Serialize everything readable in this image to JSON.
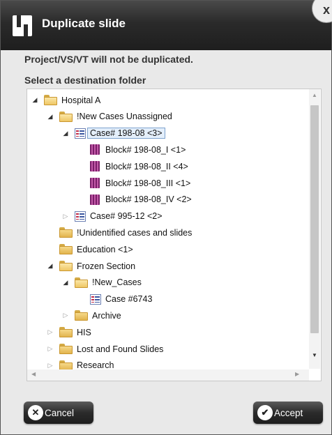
{
  "dialog": {
    "title": "Duplicate slide",
    "close_label": "x",
    "message": "Project/VS/VT will not be duplicated.",
    "select_label": "Select a destination folder"
  },
  "tree": {
    "items": [
      {
        "label": "Hospital A",
        "icon": "folder-open-icon",
        "expander": "expanded",
        "depth": 0
      },
      {
        "label": "!New Cases Unassigned",
        "icon": "folder-open-icon",
        "expander": "expanded",
        "depth": 1
      },
      {
        "label": "Case# 198-08 <3>",
        "icon": "case-icon",
        "expander": "expanded",
        "depth": 2,
        "selected": true
      },
      {
        "label": "Block# 198-08_I <1>",
        "icon": "block-icon",
        "expander": "none",
        "depth": 3
      },
      {
        "label": "Block# 198-08_II <4>",
        "icon": "block-icon",
        "expander": "none",
        "depth": 3
      },
      {
        "label": "Block# 198-08_III <1>",
        "icon": "block-icon",
        "expander": "none",
        "depth": 3
      },
      {
        "label": "Block# 198-08_IV <2>",
        "icon": "block-icon",
        "expander": "none",
        "depth": 3
      },
      {
        "label": "Case# 995-12 <2>",
        "icon": "case-icon",
        "expander": "collapsed",
        "depth": 2
      },
      {
        "label": "!Unidentified cases and slides",
        "icon": "folder-icon",
        "expander": "none",
        "depth": 1
      },
      {
        "label": "Education <1>",
        "icon": "folder-icon",
        "expander": "none",
        "depth": 1
      },
      {
        "label": "Frozen Section",
        "icon": "folder-open-icon",
        "expander": "expanded",
        "depth": 1
      },
      {
        "label": "!New_Cases",
        "icon": "folder-open-icon",
        "expander": "expanded",
        "depth": 2
      },
      {
        "label": "Case #6743",
        "icon": "case-icon",
        "expander": "none",
        "depth": 3
      },
      {
        "label": "Archive",
        "icon": "folder-icon",
        "expander": "collapsed",
        "depth": 2
      },
      {
        "label": "HIS",
        "icon": "folder-icon",
        "expander": "collapsed",
        "depth": 1
      },
      {
        "label": "Lost and Found Slides",
        "icon": "folder-icon",
        "expander": "collapsed",
        "depth": 1
      },
      {
        "label": "Research",
        "icon": "folder-icon",
        "expander": "collapsed",
        "depth": 1
      }
    ]
  },
  "buttons": {
    "cancel": "Cancel",
    "accept": "Accept"
  }
}
